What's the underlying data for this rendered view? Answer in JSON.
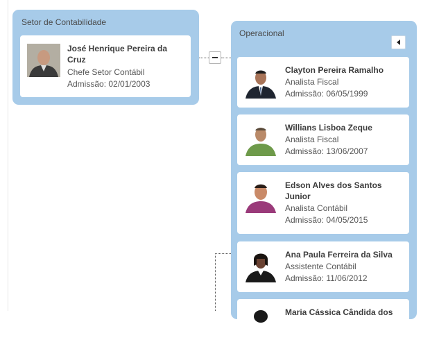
{
  "left_panel": {
    "title": "Setor de Contabilidade",
    "person": {
      "name_line1": "José Henrique Pereira da",
      "name_line2": "Cruz",
      "role": "Chefe Setor Contábil",
      "admission": "Admissão: 02/01/2003"
    },
    "collapse_icon": "minus-icon"
  },
  "right_panel": {
    "title": "Operacional",
    "toggle_icon": "triangle-left-icon",
    "people": [
      {
        "name_line1": "Clayton Pereira Ramalho",
        "name_line2": "",
        "role": "Analista Fiscal",
        "admission": "Admissão: 06/05/1999"
      },
      {
        "name_line1": "Willians Lisboa Zeque",
        "name_line2": "",
        "role": "Analista Fiscal",
        "admission": "Admissão: 13/06/2007"
      },
      {
        "name_line1": "Edson Alves dos Santos",
        "name_line2": "Junior",
        "role": "Analista Contábil",
        "admission": "Admissão: 04/05/2015"
      },
      {
        "name_line1": "Ana Paula Ferreira da Silva",
        "name_line2": "",
        "role": "Assistente Contábil",
        "admission": "Admissão: 11/06/2012"
      },
      {
        "name_line1": "Maria Cássica Cândida dos",
        "name_line2": "",
        "role": "",
        "admission": ""
      }
    ]
  }
}
